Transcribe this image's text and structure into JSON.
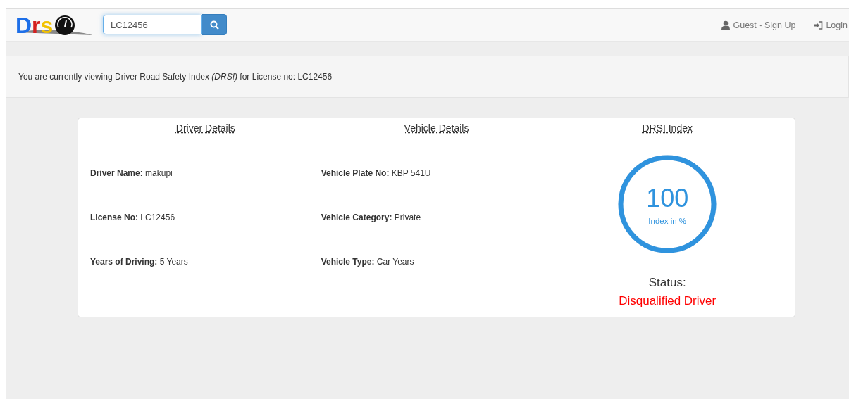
{
  "navbar": {
    "logo_letters": [
      {
        "text": "D",
        "color": "#1e6fe8"
      },
      {
        "text": "r",
        "color": "#d42020"
      },
      {
        "text": "s",
        "color": "#f2c200"
      }
    ],
    "search": {
      "value": "LC12456"
    },
    "links": [
      {
        "kind": "user",
        "label": "Guest - Sign Up"
      },
      {
        "kind": "login",
        "label": "Login"
      }
    ]
  },
  "info": {
    "text": "You are currently viewing Driver Road Safety Index *(DRSI)* for License no: LC12456"
  },
  "columns": [
    {
      "heading": "Driver Details",
      "fields": [
        {
          "label": "Driver Name:",
          "value": "makupi"
        },
        {
          "label": "License No:",
          "value": "LC12456"
        },
        {
          "label": "Years of Driving:",
          "value": "5 Years"
        }
      ]
    },
    {
      "heading": "Vehicle Details",
      "fields": [
        {
          "label": "Vehicle Plate No:",
          "value": "KBP 541U"
        },
        {
          "label": "Vehicle Category:",
          "value": "Private"
        },
        {
          "label": "Vehicle Type:",
          "value": "Car Years"
        }
      ]
    }
  ],
  "index": {
    "heading": "DRSI Index",
    "level": 1,
    "value": "100",
    "caption": "Index in %",
    "status_label": "Status:",
    "status": "Disqualified Driver"
  }
}
